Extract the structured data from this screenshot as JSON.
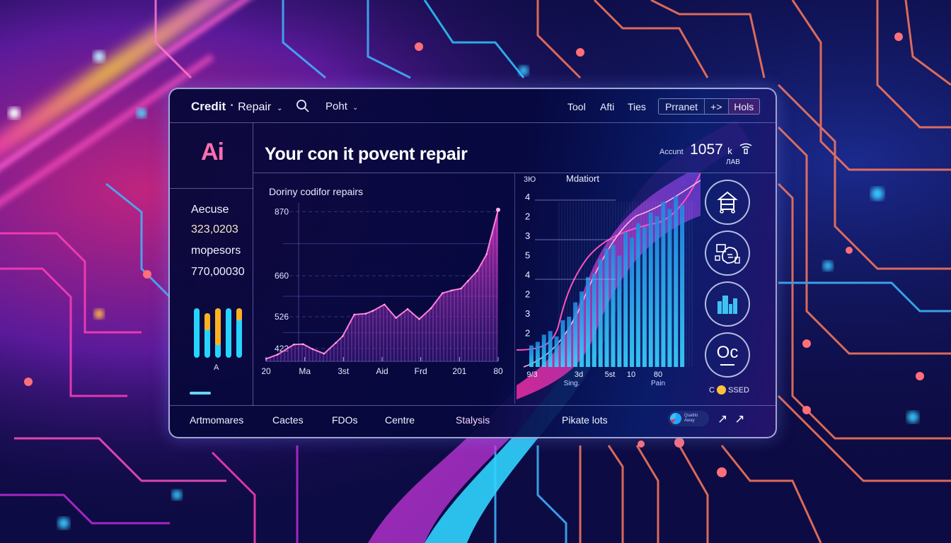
{
  "header": {
    "brand_main": "Credit",
    "brand_sep": "•",
    "brand_sub": "Repair",
    "chevron": "⌄",
    "search_icon": "search-icon",
    "menu_point": "Poht",
    "nav": [
      "Tool",
      "Afti",
      "Ties"
    ],
    "segmented": [
      "Prranet",
      "+>",
      "Hols"
    ]
  },
  "sidebar": {
    "logo": "Ai",
    "stat1_label": "Aecuse",
    "stat1_value": "323,0203",
    "stat2_label": "mopesors",
    "stat2_value": "770,00030",
    "mini_chart_label": "A",
    "mini_bars": [
      {
        "cyan": 1.0,
        "orange": 0.0
      },
      {
        "cyan": 0.55,
        "orange": 0.35
      },
      {
        "cyan": 0.3,
        "orange": 0.9
      },
      {
        "cyan": 1.0,
        "orange": 0.0
      },
      {
        "cyan": 0.75,
        "orange": 0.25
      }
    ]
  },
  "main": {
    "title": "Your con it povent repair",
    "chart_title": "Doriny codifor repairs"
  },
  "account": {
    "label": "Accunt",
    "value": "1057",
    "unit": "k",
    "sub": "ЛAB"
  },
  "right_chart": {
    "title": "Mdatiort",
    "corner_label": "3Ю",
    "y_labels": [
      "4",
      "2",
      "3",
      "5",
      "4",
      "2",
      "3",
      "2"
    ],
    "x_labels": [
      "9/3",
      "3d",
      "5st",
      "10",
      "80"
    ],
    "x_sublabels": [
      "Sing.",
      "",
      "Pain"
    ],
    "bars": [
      0.12,
      0.14,
      0.18,
      0.2,
      0.17,
      0.26,
      0.28,
      0.36,
      0.42,
      0.5,
      0.52,
      0.6,
      0.66,
      0.68,
      0.62,
      0.75,
      0.72,
      0.8,
      0.78,
      0.86,
      0.84,
      0.92,
      0.88,
      0.95,
      0.9
    ]
  },
  "icons": [
    {
      "name": "house-icon"
    },
    {
      "name": "documents-icon"
    },
    {
      "name": "bar-chart-icon"
    },
    {
      "name": "oc-logo-icon",
      "text": "Oc"
    }
  ],
  "status": {
    "left": "C",
    "right": "SSED",
    "color": "#ffc23a"
  },
  "footer": {
    "tabs": [
      "Artmomares",
      "Cactes",
      "FDOs",
      "Centre",
      "Stalysis",
      "Pikate lots"
    ],
    "pill_text_1": "Quattlo",
    "pill_text_2": "Away",
    "arrow_icons": [
      "↗",
      "↗"
    ]
  },
  "colors": {
    "accent_pink": "#ff6fae",
    "line_pink": "#ff5fc8",
    "cyan": "#27d4ff",
    "orange": "#ffb020",
    "panel": "#080a3a"
  },
  "chart_data": {
    "type": "area",
    "title": "Doriny codifor repairs",
    "x_tick_labels": [
      "20",
      "Ma",
      "3st",
      "Aid",
      "Frd",
      "201",
      "80"
    ],
    "y_tick_labels": [
      "422",
      "526",
      "660",
      "870"
    ],
    "ylim": [
      380,
      880
    ],
    "points": [
      {
        "x": 0.0,
        "y": 388
      },
      {
        "x": 0.05,
        "y": 402
      },
      {
        "x": 0.12,
        "y": 435
      },
      {
        "x": 0.16,
        "y": 436
      },
      {
        "x": 0.2,
        "y": 420
      },
      {
        "x": 0.25,
        "y": 405
      },
      {
        "x": 0.3,
        "y": 440
      },
      {
        "x": 0.33,
        "y": 462
      },
      {
        "x": 0.38,
        "y": 533
      },
      {
        "x": 0.43,
        "y": 536
      },
      {
        "x": 0.46,
        "y": 545
      },
      {
        "x": 0.51,
        "y": 566
      },
      {
        "x": 0.56,
        "y": 522
      },
      {
        "x": 0.61,
        "y": 551
      },
      {
        "x": 0.66,
        "y": 518
      },
      {
        "x": 0.71,
        "y": 553
      },
      {
        "x": 0.76,
        "y": 603
      },
      {
        "x": 0.8,
        "y": 612
      },
      {
        "x": 0.84,
        "y": 618
      },
      {
        "x": 0.87,
        "y": 643
      },
      {
        "x": 0.91,
        "y": 676
      },
      {
        "x": 0.95,
        "y": 730
      },
      {
        "x": 1.0,
        "y": 876
      }
    ],
    "grid": true,
    "legend": "none"
  }
}
